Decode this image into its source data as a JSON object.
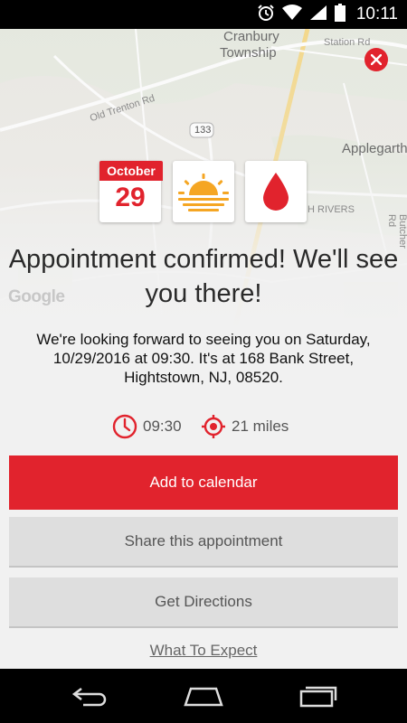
{
  "status_bar": {
    "time": "10:11",
    "icons": [
      "alarm-icon",
      "wifi-icon",
      "signal-icon",
      "battery-icon"
    ]
  },
  "map": {
    "labels": {
      "cranbury": "Cranbury",
      "township": "Township",
      "station_rd": "Station Rd",
      "old_trenton_rd": "Old Trenton Rd",
      "route_133": "133",
      "applegarth": "Applegarth",
      "rivers": "H RIVERS",
      "butcher_rd": "Butcher Rd",
      "google": "Google"
    }
  },
  "tiles": {
    "month": "October",
    "day": "29",
    "time_of_day_icon": "sunrise-icon",
    "donation_icon": "blood-drop-icon"
  },
  "headline": "Appointment confirmed! We'll see you there!",
  "body": "We're looking forward to seeing you on Saturday, 10/29/2016 at 09:30. It's at 168 Bank Street, Hightstown, NJ, 08520.",
  "meta": {
    "time": "09:30",
    "distance": "21 miles"
  },
  "actions": {
    "add_to_calendar": "Add to calendar",
    "share": "Share this appointment",
    "directions": "Get Directions",
    "what_to_expect": "What To Expect"
  },
  "colors": {
    "accent": "#e1232d",
    "background": "#f1f1f1",
    "secondary_button": "#dedede"
  }
}
